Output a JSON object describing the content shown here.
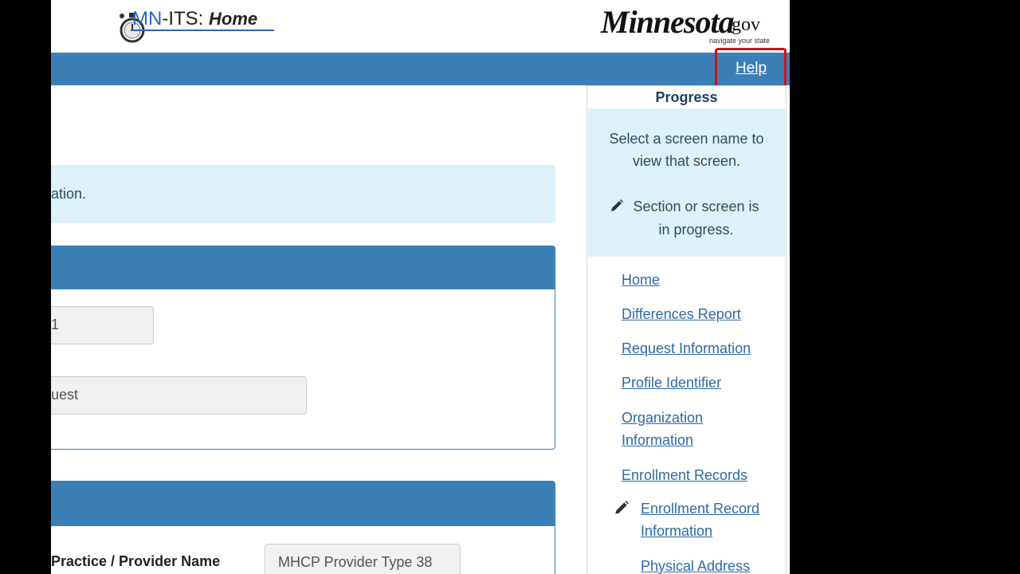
{
  "header": {
    "app_title_prefix": "MN",
    "app_title_suffix": "-ITS: ",
    "app_title_home": "Home",
    "state_logo": "Minnesota",
    "state_logo_gov": ".gov",
    "state_logo_tagline": "navigate your state"
  },
  "nav": {
    "help_label": "Help"
  },
  "main": {
    "info_text_partial": "ation.",
    "field1_partial": "1",
    "field2_partial": "uest",
    "practice_label_partial": "Practice / Provider Name",
    "practice_value": "MHCP Provider Type 38"
  },
  "sidebar": {
    "title": "Progress",
    "info_line1": "Select a screen name to view that screen.",
    "info_line2": "Section or screen is in progress.",
    "links": [
      {
        "label": "Home"
      },
      {
        "label": "Differences Report"
      },
      {
        "label": "Request Information"
      },
      {
        "label": "Profile Identifier"
      },
      {
        "label": "Organization Information"
      },
      {
        "label": "Enrollment Records"
      },
      {
        "label": "Enrollment Record Information",
        "in_progress": true
      },
      {
        "label": "Physical Address"
      }
    ]
  },
  "colors": {
    "accent_blue": "#3b7fb7",
    "info_background": "#def0f8",
    "link_blue": "#2b6aa8",
    "help_highlight": "#c4151c"
  },
  "icons": [
    "stopwatch-logo-icon",
    "pencil-icon"
  ]
}
